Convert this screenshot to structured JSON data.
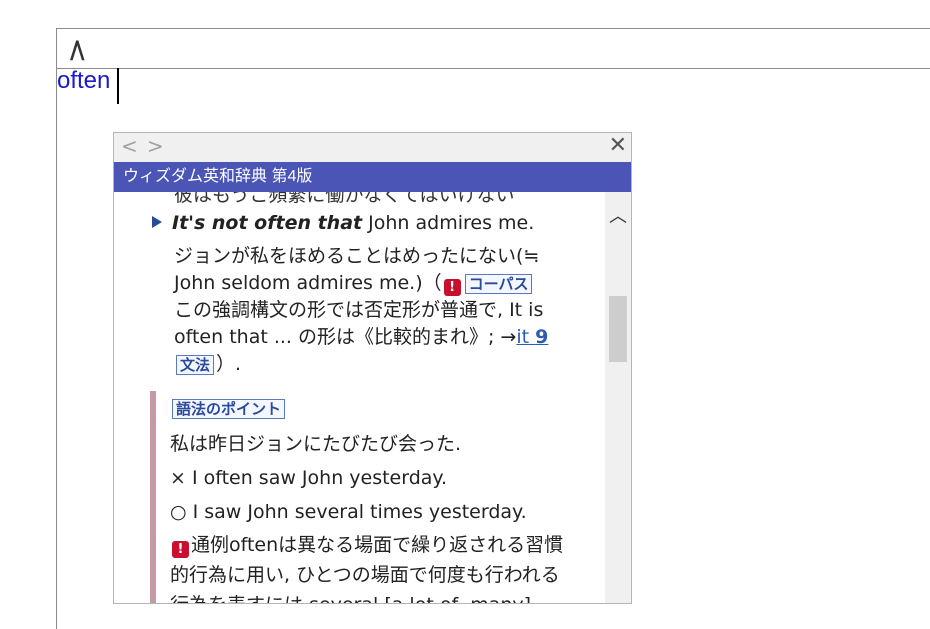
{
  "app": {
    "logo": "/\\"
  },
  "editor": {
    "word": "often"
  },
  "popup": {
    "nav_back": "<",
    "nav_forward": ">",
    "close": "✕",
    "dictionary_title": "ウィズダム英和辞典 第4版",
    "cut_off_line": "彼はもうこ頻繁に働かなくてはいけない",
    "example": {
      "bold_phrase": "It's not often that",
      "rest": " John admires me."
    },
    "translation": {
      "line1": "ジョンが私をほめることはめったにない(≒",
      "line2": "John seldom admires me.)（",
      "alert_icon": "!",
      "corpus_tag": "コーパス",
      "line3": "この強調構文の形では否定形が普通で, It is",
      "line4_start": "often that ... の形は《比較的まれ》; →",
      "link_text": "it",
      "link_num": "9",
      "grammar_tag": "文法",
      "line5_end": "）."
    },
    "usage": {
      "title": "語法のポイント",
      "line1": "私は昨日ジョンにたびたび会った.",
      "line2": "× I often saw John yesterday.",
      "line3": "○ I saw John several times yesterday.",
      "note_icon": "!",
      "note1": "通例oftenは異なる場面で繰り返される習慣",
      "note2": "的行為に用い, ひとつの場面で何度も行われる",
      "note3": "行為を表すには several [a lot of, many]"
    },
    "scroll_up": "︿"
  }
}
